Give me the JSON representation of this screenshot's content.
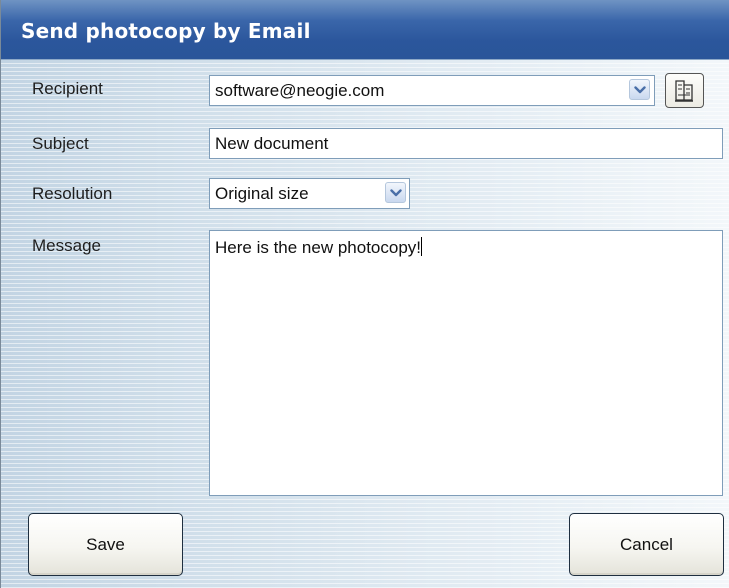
{
  "dialog": {
    "title": "Send photocopy by Email"
  },
  "form": {
    "recipient": {
      "label": "Recipient",
      "value": "software@neogie.com"
    },
    "subject": {
      "label": "Subject",
      "value": "New document"
    },
    "resolution": {
      "label": "Resolution",
      "value": "Original size"
    },
    "message": {
      "label": "Message",
      "value": "Here is the new photocopy!"
    }
  },
  "buttons": {
    "save_label": "Save",
    "cancel_label": "Cancel"
  },
  "icons": {
    "combo_arrow": "chevron-down-icon",
    "address_book": "address-book-icon"
  },
  "colors": {
    "title_bar": "#2b569c",
    "title_text": "#ffffff",
    "field_border": "#7f9db9",
    "arrow": "#4a6fa8"
  }
}
